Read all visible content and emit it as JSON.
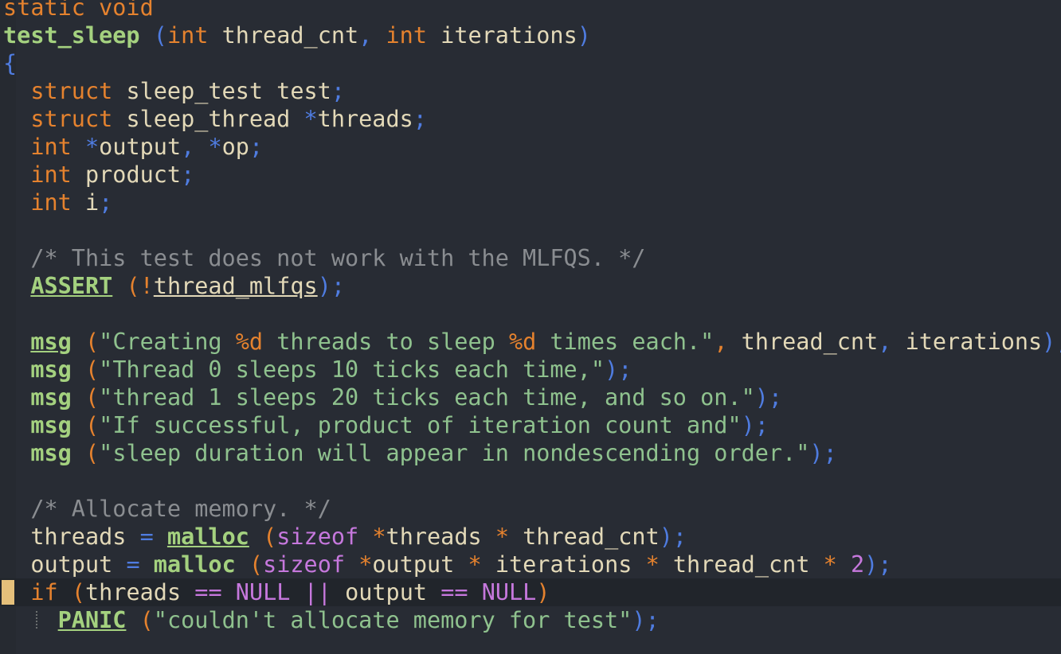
{
  "editor": {
    "language": "c",
    "cursor_line": 21,
    "colors": {
      "background": "#282c34",
      "keyword": "#e5822e",
      "function": "#a4d17f",
      "string": "#8fc28e",
      "punctuation": "#4f7ce0",
      "comment": "#8a8d91",
      "constant": "#c678dd",
      "cursor_marker": "#e5c07b"
    },
    "lines": [
      [
        {
          "t": "static void",
          "c": "kw"
        }
      ],
      [
        {
          "t": "test_sleep",
          "c": "fn"
        },
        {
          "t": " ",
          "c": "id"
        },
        {
          "t": "(",
          "c": "pn"
        },
        {
          "t": "int",
          "c": "kw"
        },
        {
          "t": " thread_cnt",
          "c": "id"
        },
        {
          "t": ",",
          "c": "pn"
        },
        {
          "t": " ",
          "c": "id"
        },
        {
          "t": "int",
          "c": "kw"
        },
        {
          "t": " iterations",
          "c": "id"
        },
        {
          "t": ")",
          "c": "pn"
        }
      ],
      [
        {
          "t": "{",
          "c": "pn"
        }
      ],
      [
        {
          "t": "  ",
          "c": "id"
        },
        {
          "t": "struct",
          "c": "kw"
        },
        {
          "t": " sleep_test test",
          "c": "id"
        },
        {
          "t": ";",
          "c": "pn"
        }
      ],
      [
        {
          "t": "  ",
          "c": "id"
        },
        {
          "t": "struct",
          "c": "kw"
        },
        {
          "t": " sleep_thread ",
          "c": "id"
        },
        {
          "t": "*",
          "c": "pn"
        },
        {
          "t": "threads",
          "c": "id"
        },
        {
          "t": ";",
          "c": "pn"
        }
      ],
      [
        {
          "t": "  ",
          "c": "id"
        },
        {
          "t": "int",
          "c": "kw"
        },
        {
          "t": " ",
          "c": "id"
        },
        {
          "t": "*",
          "c": "pn"
        },
        {
          "t": "output",
          "c": "id"
        },
        {
          "t": ",",
          "c": "pn"
        },
        {
          "t": " ",
          "c": "id"
        },
        {
          "t": "*",
          "c": "pn"
        },
        {
          "t": "op",
          "c": "id"
        },
        {
          "t": ";",
          "c": "pn"
        }
      ],
      [
        {
          "t": "  ",
          "c": "id"
        },
        {
          "t": "int",
          "c": "kw"
        },
        {
          "t": " product",
          "c": "id"
        },
        {
          "t": ";",
          "c": "pn"
        }
      ],
      [
        {
          "t": "  ",
          "c": "id"
        },
        {
          "t": "int",
          "c": "kw"
        },
        {
          "t": " i",
          "c": "id"
        },
        {
          "t": ";",
          "c": "pn"
        }
      ],
      [],
      [
        {
          "t": "  ",
          "c": "id"
        },
        {
          "t": "/* This test does not work with the MLFQS. */",
          "c": "cm"
        }
      ],
      [
        {
          "t": "  ",
          "c": "id"
        },
        {
          "t": "ASSERT",
          "c": "fnu"
        },
        {
          "t": " ",
          "c": "id"
        },
        {
          "t": "(!",
          "c": "kw"
        },
        {
          "t": "thread_mlfqs",
          "c": "idu"
        },
        {
          "t": ");",
          "c": "pn"
        }
      ],
      [],
      [
        {
          "t": "  ",
          "c": "id"
        },
        {
          "t": "msg",
          "c": "fnu"
        },
        {
          "t": " ",
          "c": "id"
        },
        {
          "t": "(",
          "c": "kw"
        },
        {
          "t": "\"Creating ",
          "c": "str"
        },
        {
          "t": "%d",
          "c": "fmt"
        },
        {
          "t": " threads to sleep ",
          "c": "str"
        },
        {
          "t": "%d",
          "c": "fmt"
        },
        {
          "t": " times each.\"",
          "c": "str"
        },
        {
          "t": ",",
          "c": "kw"
        },
        {
          "t": " thread_cnt",
          "c": "id"
        },
        {
          "t": ",",
          "c": "pn"
        },
        {
          "t": " iterations",
          "c": "id"
        },
        {
          "t": ");",
          "c": "pn"
        }
      ],
      [
        {
          "t": "  ",
          "c": "id"
        },
        {
          "t": "msg",
          "c": "fn"
        },
        {
          "t": " ",
          "c": "id"
        },
        {
          "t": "(",
          "c": "kw"
        },
        {
          "t": "\"Thread 0 sleeps 10 ticks each time,\"",
          "c": "str"
        },
        {
          "t": ");",
          "c": "pn"
        }
      ],
      [
        {
          "t": "  ",
          "c": "id"
        },
        {
          "t": "msg",
          "c": "fn"
        },
        {
          "t": " ",
          "c": "id"
        },
        {
          "t": "(",
          "c": "kw"
        },
        {
          "t": "\"thread 1 sleeps 20 ticks each time, and so on.\"",
          "c": "str"
        },
        {
          "t": ");",
          "c": "pn"
        }
      ],
      [
        {
          "t": "  ",
          "c": "id"
        },
        {
          "t": "msg",
          "c": "fn"
        },
        {
          "t": " ",
          "c": "id"
        },
        {
          "t": "(",
          "c": "kw"
        },
        {
          "t": "\"If successful, product of iteration count and\"",
          "c": "str"
        },
        {
          "t": ");",
          "c": "pn"
        }
      ],
      [
        {
          "t": "  ",
          "c": "id"
        },
        {
          "t": "msg",
          "c": "fn"
        },
        {
          "t": " ",
          "c": "id"
        },
        {
          "t": "(",
          "c": "kw"
        },
        {
          "t": "\"sleep duration will appear in nondescending order.\"",
          "c": "str"
        },
        {
          "t": ");",
          "c": "pn"
        }
      ],
      [],
      [
        {
          "t": "  ",
          "c": "id"
        },
        {
          "t": "/* Allocate memory. */",
          "c": "cm"
        }
      ],
      [
        {
          "t": "  threads ",
          "c": "id"
        },
        {
          "t": "=",
          "c": "pn"
        },
        {
          "t": " ",
          "c": "id"
        },
        {
          "t": "malloc",
          "c": "fnu"
        },
        {
          "t": " ",
          "c": "id"
        },
        {
          "t": "(",
          "c": "kw"
        },
        {
          "t": "sizeof",
          "c": "mg"
        },
        {
          "t": " ",
          "c": "id"
        },
        {
          "t": "*",
          "c": "kw"
        },
        {
          "t": "threads ",
          "c": "id"
        },
        {
          "t": "*",
          "c": "kw"
        },
        {
          "t": " thread_cnt",
          "c": "id"
        },
        {
          "t": ");",
          "c": "pn"
        }
      ],
      [
        {
          "t": "  output ",
          "c": "id"
        },
        {
          "t": "=",
          "c": "pn"
        },
        {
          "t": " ",
          "c": "id"
        },
        {
          "t": "malloc",
          "c": "fn"
        },
        {
          "t": " ",
          "c": "id"
        },
        {
          "t": "(",
          "c": "kw"
        },
        {
          "t": "sizeof",
          "c": "mg"
        },
        {
          "t": " ",
          "c": "id"
        },
        {
          "t": "*",
          "c": "kw"
        },
        {
          "t": "output ",
          "c": "id"
        },
        {
          "t": "*",
          "c": "kw"
        },
        {
          "t": " iterations ",
          "c": "id"
        },
        {
          "t": "*",
          "c": "kw"
        },
        {
          "t": " thread_cnt ",
          "c": "id"
        },
        {
          "t": "*",
          "c": "kw"
        },
        {
          "t": " ",
          "c": "id"
        },
        {
          "t": "2",
          "c": "mg"
        },
        {
          "t": ");",
          "c": "pn"
        }
      ],
      [
        {
          "t": "  ",
          "c": "id"
        },
        {
          "t": "if",
          "c": "kw"
        },
        {
          "t": " ",
          "c": "id"
        },
        {
          "t": "(",
          "c": "kw"
        },
        {
          "t": "threads ",
          "c": "id"
        },
        {
          "t": "==",
          "c": "mg"
        },
        {
          "t": " ",
          "c": "id"
        },
        {
          "t": "NULL",
          "c": "mg"
        },
        {
          "t": " ",
          "c": "id"
        },
        {
          "t": "||",
          "c": "mg"
        },
        {
          "t": " output ",
          "c": "id"
        },
        {
          "t": "==",
          "c": "mg"
        },
        {
          "t": " ",
          "c": "id"
        },
        {
          "t": "NULL",
          "c": "mg"
        },
        {
          "t": ")",
          "c": "kw"
        }
      ],
      [
        {
          "t": "    ",
          "c": "id"
        },
        {
          "t": "PANIC",
          "c": "fnu"
        },
        {
          "t": " ",
          "c": "id"
        },
        {
          "t": "(",
          "c": "kw"
        },
        {
          "t": "\"couldn't allocate memory for test\"",
          "c": "str"
        },
        {
          "t": ");",
          "c": "pn"
        }
      ]
    ]
  }
}
